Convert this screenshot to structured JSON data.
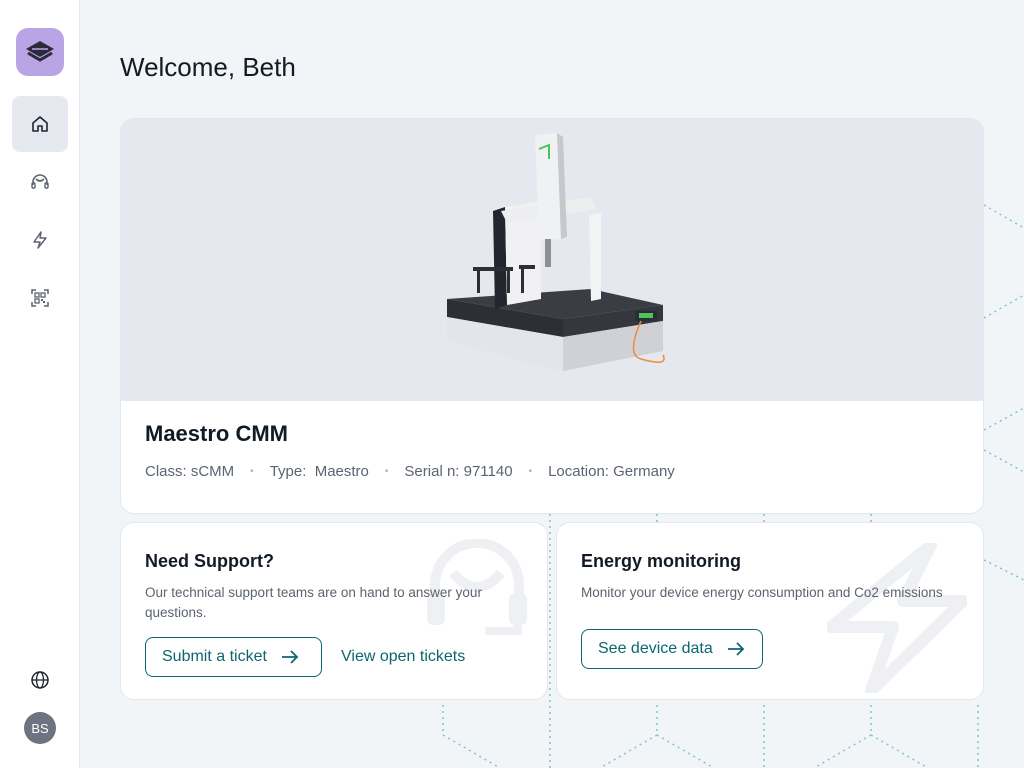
{
  "user": {
    "initials": "BS"
  },
  "header": {
    "greeting": "Welcome, Beth"
  },
  "nav": [
    {
      "icon": "home-icon",
      "active": true
    },
    {
      "icon": "headset-icon",
      "active": false
    },
    {
      "icon": "lightning-icon",
      "active": false
    },
    {
      "icon": "qr-scan-icon",
      "active": false
    }
  ],
  "device": {
    "name": "Maestro CMM",
    "class": "Class: sCMM",
    "type": "Type:  Maestro",
    "serial": "Serial n: 971140",
    "location": "Location: Germany",
    "separator": "•"
  },
  "support": {
    "title": "Need Support?",
    "description": "Our technical support teams are on hand to answer your questions.",
    "submit_label": "Submit a ticket",
    "view_label": "View open tickets"
  },
  "energy": {
    "title": "Energy monitoring",
    "description": "Monitor your device energy consumption and Co2 emissions",
    "button_label": "See device data"
  },
  "colors": {
    "accent": "#0c6670",
    "logo_bg": "#b9a4e6",
    "background": "#f2f5f8"
  }
}
